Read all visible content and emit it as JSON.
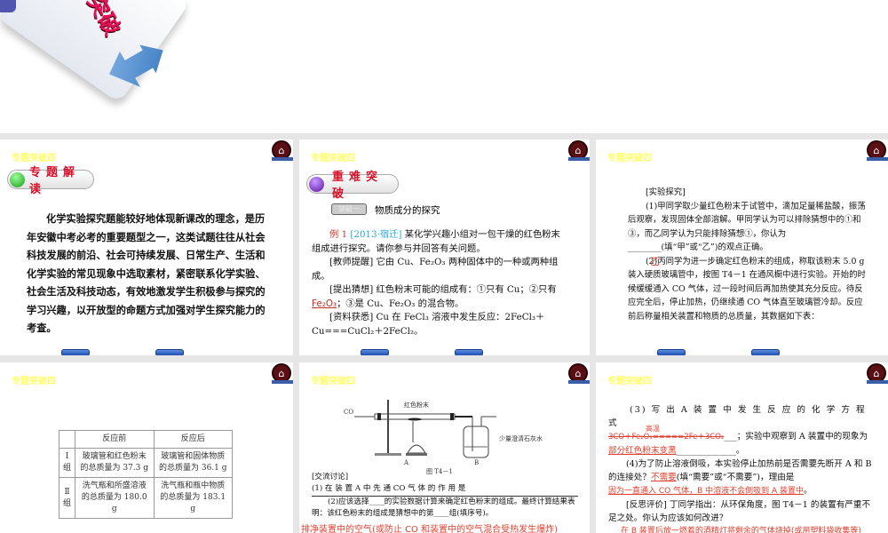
{
  "top_slide": {
    "title_fragment": "突破"
  },
  "slide_header": "专题突破四",
  "slide1": {
    "pill": "专题解读",
    "body": "化学实验探究题能较好地体现新课改的理念，是历年安徽中考必考的重要题型之一，这类试题往往从社会科技发展的前沿、社会可持续发展、日常生产、生活和化学实验的常见现象中选取素材，紧密联系化学实验、社会生活及科技动态，有效地激发学生积极参与探究的学习兴趣，以开放型的命题方式加强对学生探究能力的考查。"
  },
  "slide2": {
    "pill": "重难突破",
    "badge": "突破一",
    "topic": "物质成分的探究",
    "ex_label": "例 1",
    "ex_src": "[2013·宿迁]",
    "ex_text": "某化学兴趣小组对一包干燥的红色粉末组成进行探究。请你参与并回答有关问题。",
    "hint": "[教师提醒] 它由 Cu、Fe₂O₃ 两种固体中的一种或两种组成。",
    "guess_a": "[提出猜想] 红色粉末可能的组成有：①只有 Cu；②只有",
    "guess_ans": "Fe₂O₃",
    "guess_b": "；③是 Cu、Fe₂O₃ 的混合物。",
    "info": "[资料获悉] Cu 在 FeCl₃ 溶液中发生反应：2FeCl₃＋Cu===CuCl₂＋2FeCl₂。"
  },
  "slide3": {
    "heading": "[实验探究]",
    "p1": "(1)甲同学取少量红色粉末于试管中，滴加足量稀盐酸，振荡后观察，发现固体全部溶解。甲同学认为可以排除猜想中的①和③，而乙同学认为只能排除猜想①，你认为________(填“甲”或“乙”)的观点正确。",
    "ans1": "乙",
    "p2": "(2)丙同学为进一步确定红色粉末的组成，称取该粉末 5.0 g 装入硬质玻璃管中，按图 T4－1 在通风橱中进行实验。开始的时候缓缓通入 CO 气体，过一段时间后再加热使其充分反应。待反应完全后，停止加热，仍继续通 CO 气体直至玻璃管冷却。反应前后称量相关装置和物质的总质量，其数据如下表："
  },
  "slide4": {
    "headers": [
      "",
      "反应前",
      "反应后"
    ],
    "rows": [
      [
        "Ⅰ组",
        "玻璃管和红色粉末的总质量为 37.3 g",
        "玻璃管和固体物质的总质量为 36.1 g"
      ],
      [
        "Ⅱ组",
        "洗气瓶和所盛溶液的总质量为 180.0 g",
        "洗气瓶和瓶中物质的总质量为 183.1 g"
      ]
    ]
  },
  "slide5": {
    "co": "CO",
    "powder": "红色粉末",
    "lime": "少量澄清石灰水",
    "a": "A",
    "b": "B",
    "fig": "图 T4－1",
    "disc": "[交流讨论]",
    "q1": "(1) 在 装 置 A 中 先 通 CO 气 体 的 作 用 是",
    "q2": "(2)应该选择____的实验数据计算来确定红色粉末的组成。最终计算结果表明：该红色粉末的组成是猜想中的第____组(填序号)。",
    "ans": "排净装置中的空气(或防止 CO 和装置中的空气混合受热发生爆炸)"
  },
  "slide6": {
    "q3a": "(3) 写 出 A 装 置 中 发 生 反 应 的 化 学 方 程 式",
    "eq_cond": "高温",
    "eq": "3CO＋Fe₂O₃=====2Fe＋3CO₂",
    "q3b": "；实验中观察到 A 装置中的现象为",
    "ans3": "部分红色粉末变黑",
    "q4": "(4)为了防止溶液倒吸，本实验停止加热前是否需要先断开 A 和 B 的连接处？",
    "ans4a": "不需要",
    "q4b": "(填“需要”或“不需要”)，理由是",
    "ans4b": "因为一直通入 CO 气体，B 中溶液不会倒吸到 A 装置中",
    "reflect": "[反思评价] 丁同学指出：从环保角度，图 T4－1 的装置有严重不足之处。你认为应该如何改进？",
    "ans5": "在 B 装置后放一燃着的酒精灯将剩余的气体烧掉(或用塑料袋收集等)"
  }
}
